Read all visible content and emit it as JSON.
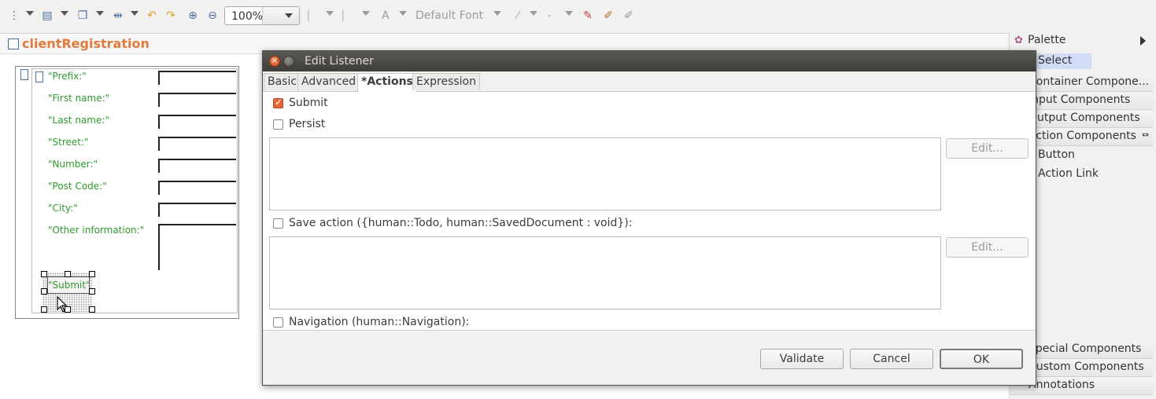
{
  "toolbar": {
    "zoom": "100%",
    "font": "Default Font",
    "font_letter": "A"
  },
  "editor": {
    "title": "clientRegistration"
  },
  "form": {
    "labels": [
      "\"Prefix:\"",
      "\"First name:\"",
      "\"Last name:\"",
      "\"Street:\"",
      "\"Number:\"",
      "\"Post Code:\"",
      "\"City:\"",
      "\"Other information:\""
    ],
    "submit_label": "\"Submit\""
  },
  "palette": {
    "title": "Palette",
    "select": "Select",
    "drawers": [
      "Container Compone...",
      "Input Components",
      "Output Components",
      "Action Components"
    ],
    "action_items": [
      "Button",
      "Action Link"
    ],
    "bottom_drawers": [
      "Special Components",
      "Custom Components",
      "Annotations"
    ]
  },
  "dialog": {
    "title": "Edit Listener",
    "tabs": [
      "Basic",
      "Advanced",
      "*Actions",
      "Expression"
    ],
    "active_tab": "*Actions",
    "submit_label": "Submit",
    "submit_checked": true,
    "persist_label": "Persist",
    "save_action_label": "Save action ({human::Todo, human::SavedDocument : void}):",
    "navigation_label": "Navigation (human::Navigation):",
    "edit_label": "Edit...",
    "buttons": {
      "validate": "Validate",
      "cancel": "Cancel",
      "ok": "OK"
    }
  }
}
